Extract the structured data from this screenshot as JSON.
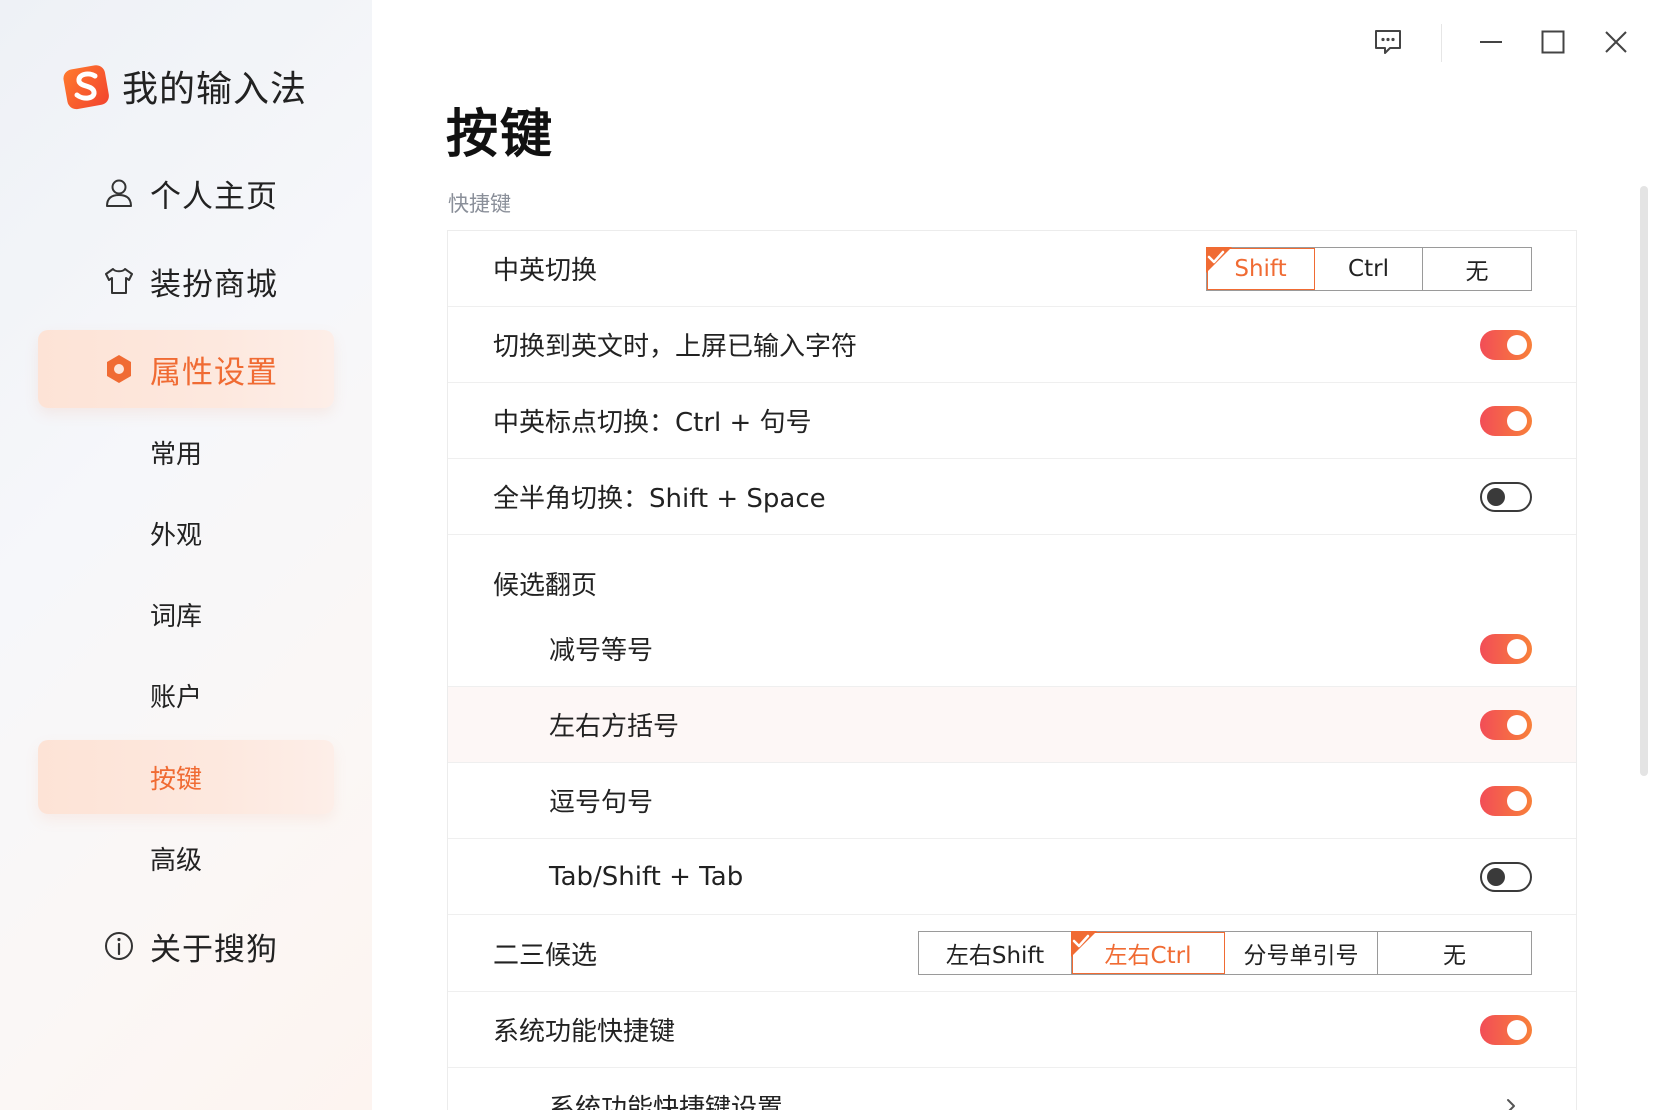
{
  "app": {
    "title": "我的输入法",
    "brand_color": "#f06b33"
  },
  "sidebar": {
    "nav": [
      {
        "label": "个人主页",
        "icon": "user-icon"
      },
      {
        "label": "装扮商城",
        "icon": "tshirt-icon"
      },
      {
        "label": "属性设置",
        "icon": "settings-hex-icon",
        "active": true
      },
      {
        "label": "关于搜狗",
        "icon": "info-icon"
      }
    ],
    "sub": [
      {
        "label": "常用"
      },
      {
        "label": "外观"
      },
      {
        "label": "词库"
      },
      {
        "label": "账户"
      },
      {
        "label": "按键",
        "active": true
      },
      {
        "label": "高级"
      }
    ]
  },
  "window": {
    "controls": [
      "feedback-icon",
      "minimize-icon",
      "maximize-icon",
      "close-icon"
    ]
  },
  "main": {
    "title": "按键",
    "section_label": "快捷键",
    "rows": {
      "cn_en_switch": {
        "label": "中英切换",
        "options": [
          "Shift",
          "Ctrl",
          "无"
        ],
        "selected": "Shift"
      },
      "commit_on_switch": {
        "label": "切换到英文时，上屏已输入字符",
        "on": true
      },
      "punct_switch": {
        "label": "中英标点切换：Ctrl + 句号",
        "on": true
      },
      "width_switch": {
        "label": "全半角切换：Shift + Space",
        "on": false
      },
      "page_turn": {
        "label": "候选翻页"
      },
      "minus_equal": {
        "label": "减号等号",
        "on": true
      },
      "brackets": {
        "label": "左右方括号",
        "on": true
      },
      "comma_period": {
        "label": "逗号句号",
        "on": true
      },
      "tab": {
        "label": "Tab/Shift + Tab",
        "on": false
      },
      "second_third": {
        "label": "二三候选",
        "options": [
          "左右Shift",
          "左右Ctrl",
          "分号单引号",
          "无"
        ],
        "selected": "左右Ctrl"
      },
      "sys_shortcuts": {
        "label": "系统功能快捷键",
        "on": true
      },
      "sys_shortcuts_settings": {
        "label": "系统功能快捷键设置"
      }
    }
  }
}
